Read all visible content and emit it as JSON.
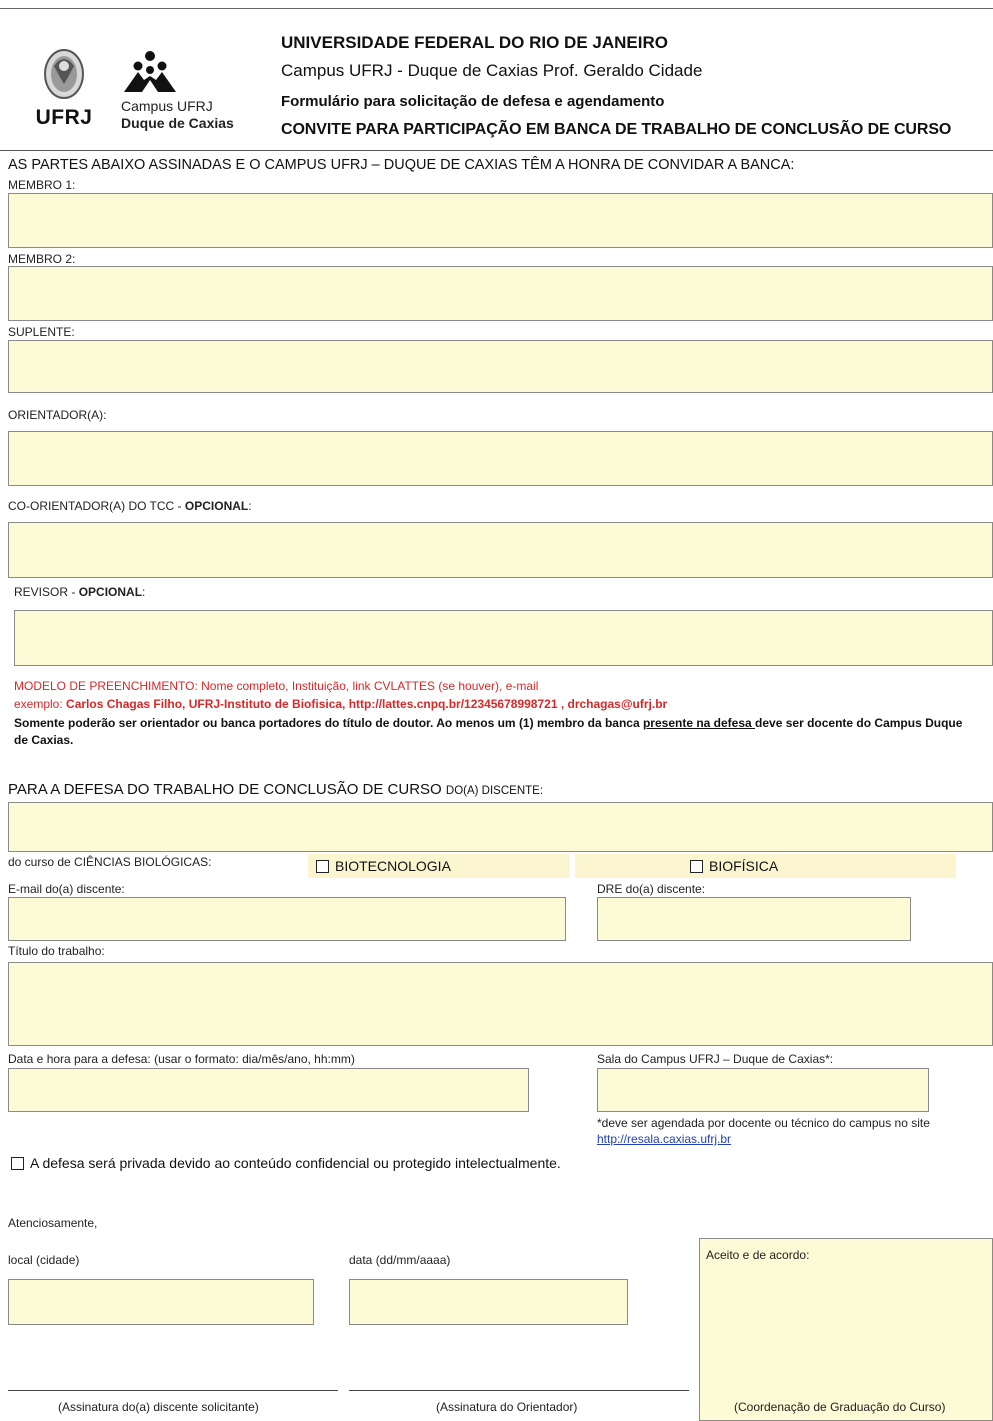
{
  "logos": {
    "ufrj_wordmark": "UFRJ",
    "campus_line1": "Campus UFRJ",
    "campus_line2": "Duque de Caxias"
  },
  "header": {
    "university": "UNIVERSIDADE FEDERAL DO RIO DE JANEIRO",
    "campus": "Campus UFRJ - Duque de Caxias Prof. Geraldo Cidade",
    "form_title": "Formulário para solicitação de defesa e agendamento",
    "invitation_title": "CONVITE PARA PARTICIPAÇÃO EM BANCA DE TRABALHO DE CONCLUSÃO DE CURSO"
  },
  "intro": "AS PARTES ABAIXO ASSINADAS E O CAMPUS UFRJ – DUQUE DE CAXIAS TÊM A HONRA DE CONVIDAR A BANCA:",
  "members": {
    "membro1": "MEMBRO 1:",
    "membro2": "MEMBRO 2:",
    "suplente": "SUPLENTE:",
    "orientador": "ORIENTADOR(A):",
    "coorientador_prefix": "CO-ORIENTADOR(A) DO TCC - ",
    "revisor_prefix": "REVISOR - ",
    "opcional": "OPCIONAL",
    "colon": ":"
  },
  "notes": {
    "model": "MODELO DE PREENCHIMENTO: Nome completo, Instituição, link CVLATTES (se houver), e-mail",
    "example_prefix": "exemplo: ",
    "example_bold": "Carlos Chagas Filho, UFRJ-Instituto de Biofisica, http://lattes.cnpq.br/12345678998721 , drchagas@ufrj.br",
    "rule_part1": "Somente poderão ser orientador ou banca portadores do título de doutor. Ao menos um (1) membro da banca ",
    "rule_underlined": "presente na defesa ",
    "rule_part2": "deve ser docente do Campus Duque de Caxias."
  },
  "student": {
    "heading_main": "PARA A DEFESA DO TRABALHO DE CONCLUSÃO DE CURSO ",
    "heading_small": "DO(A) DISCENTE:",
    "course_label": "do  curso de CIÊNCIAS BIOLÓGICAS:",
    "option_biotec": "BIOTECNOLOGIA",
    "option_biofis": "BIOFÍSICA",
    "email_label": "E-mail do(a) discente:",
    "dre_label": "DRE do(a) discente:",
    "title_label": "Título do trabalho:",
    "datetime_label": "Data e hora para a defesa: (usar o formato: dia/mês/ano, hh:mm)",
    "room_label": "Sala do Campus UFRJ – Duque de Caxias*:",
    "room_note": "*deve ser agendada por docente ou técnico do campus no site",
    "room_link": "http://resala.caxias.ufrj.br",
    "private_label": "A defesa será privada devido ao conteúdo confidencial ou protegido intelectualmente."
  },
  "closing": {
    "regards": "Atenciosamente,",
    "local_label": "local (cidade)",
    "date_label": "data (dd/mm/aaaa)",
    "accept_label": "Aceito e de acordo:",
    "sig_student": "(Assinatura do(a) discente solicitante)",
    "sig_advisor": "(Assinatura do Orientador)",
    "sig_coord": "(Coordenação de Graduação do Curso)"
  }
}
